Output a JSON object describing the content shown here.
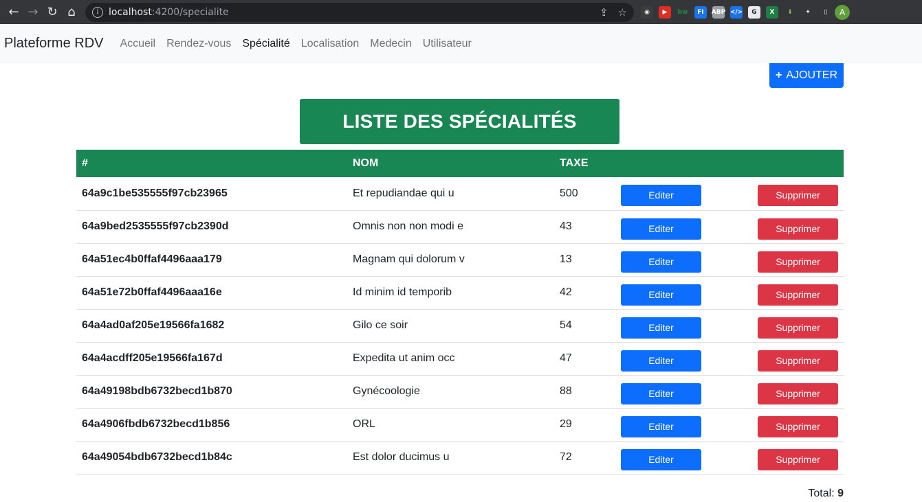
{
  "browser": {
    "url_host": "localhost",
    "url_path": ":4200/specialite",
    "avatar_letter": "A",
    "extensions": [
      {
        "name": "spy-icon",
        "glyph": "◉",
        "color": "#3c3c3c",
        "text_color": "#e8eaed"
      },
      {
        "name": "media-icon",
        "glyph": "▶",
        "color": "#d93025",
        "text_color": "#ffffff"
      },
      {
        "name": "bw-icon",
        "glyph": "bw",
        "color": "#35363a",
        "text_color": "#1e8e3e"
      },
      {
        "name": "fi-icon",
        "glyph": "FI",
        "color": "#1a73e8",
        "text_color": "#ffffff"
      },
      {
        "name": "abp-icon",
        "glyph": "ABP",
        "color": "#9aa0a6",
        "text_color": "#ffffff"
      },
      {
        "name": "code-icon",
        "glyph": "</>",
        "color": "#1a73e8",
        "text_color": "#ffffff"
      },
      {
        "name": "g-icon",
        "glyph": "G",
        "color": "#e8eaed",
        "text_color": "#202124"
      },
      {
        "name": "excel-icon",
        "glyph": "X",
        "color": "#1e7e45",
        "text_color": "#ffffff"
      },
      {
        "name": "download-icon",
        "glyph": "⬇",
        "color": "#35363a",
        "text_color": "#7cb342"
      },
      {
        "name": "puzzle-icon",
        "glyph": "✦",
        "color": "#35363a",
        "text_color": "#e8eaed"
      },
      {
        "name": "sidepanel-icon",
        "glyph": "▯",
        "color": "#35363a",
        "text_color": "#e8eaed"
      }
    ]
  },
  "navbar": {
    "brand": "Plateforme RDV",
    "links": [
      "Accueil",
      "Rendez-vous",
      "Spécialité",
      "Localisation",
      "Medecin",
      "Utilisateur"
    ],
    "active": "Spécialité"
  },
  "actions": {
    "add_label": "AJOUTER",
    "add_icon": "+"
  },
  "page": {
    "title": "LISTE DES SPÉCIALITÉS"
  },
  "table": {
    "headers": [
      "#",
      "NOM",
      "TAXE"
    ],
    "edit_label": "Editer",
    "delete_label": "Supprimer",
    "rows": [
      {
        "id": "64a9c1be535555f97cb23965",
        "nom": "Et repudiandae qui u",
        "taxe": "500"
      },
      {
        "id": "64a9bed2535555f97cb2390d",
        "nom": "Omnis non non modi e",
        "taxe": "43"
      },
      {
        "id": "64a51ec4b0ffaf4496aaa179",
        "nom": "Magnam qui dolorum v",
        "taxe": "13"
      },
      {
        "id": "64a51e72b0ffaf4496aaa16e",
        "nom": "Id minim id temporib",
        "taxe": "42"
      },
      {
        "id": "64a4ad0af205e19566fa1682",
        "nom": "Gilo ce soir",
        "taxe": "54"
      },
      {
        "id": "64a4acdff205e19566fa167d",
        "nom": "Expedita ut anim occ",
        "taxe": "47"
      },
      {
        "id": "64a49198bdb6732becd1b870",
        "nom": "Gynécoologie",
        "taxe": "88"
      },
      {
        "id": "64a4906fbdb6732becd1b856",
        "nom": "ORL",
        "taxe": "29"
      },
      {
        "id": "64a49054bdb6732becd1b84c",
        "nom": "Est dolor ducimus u",
        "taxe": "72"
      }
    ]
  },
  "footer": {
    "total_label": "Total:",
    "total_value": "9"
  }
}
